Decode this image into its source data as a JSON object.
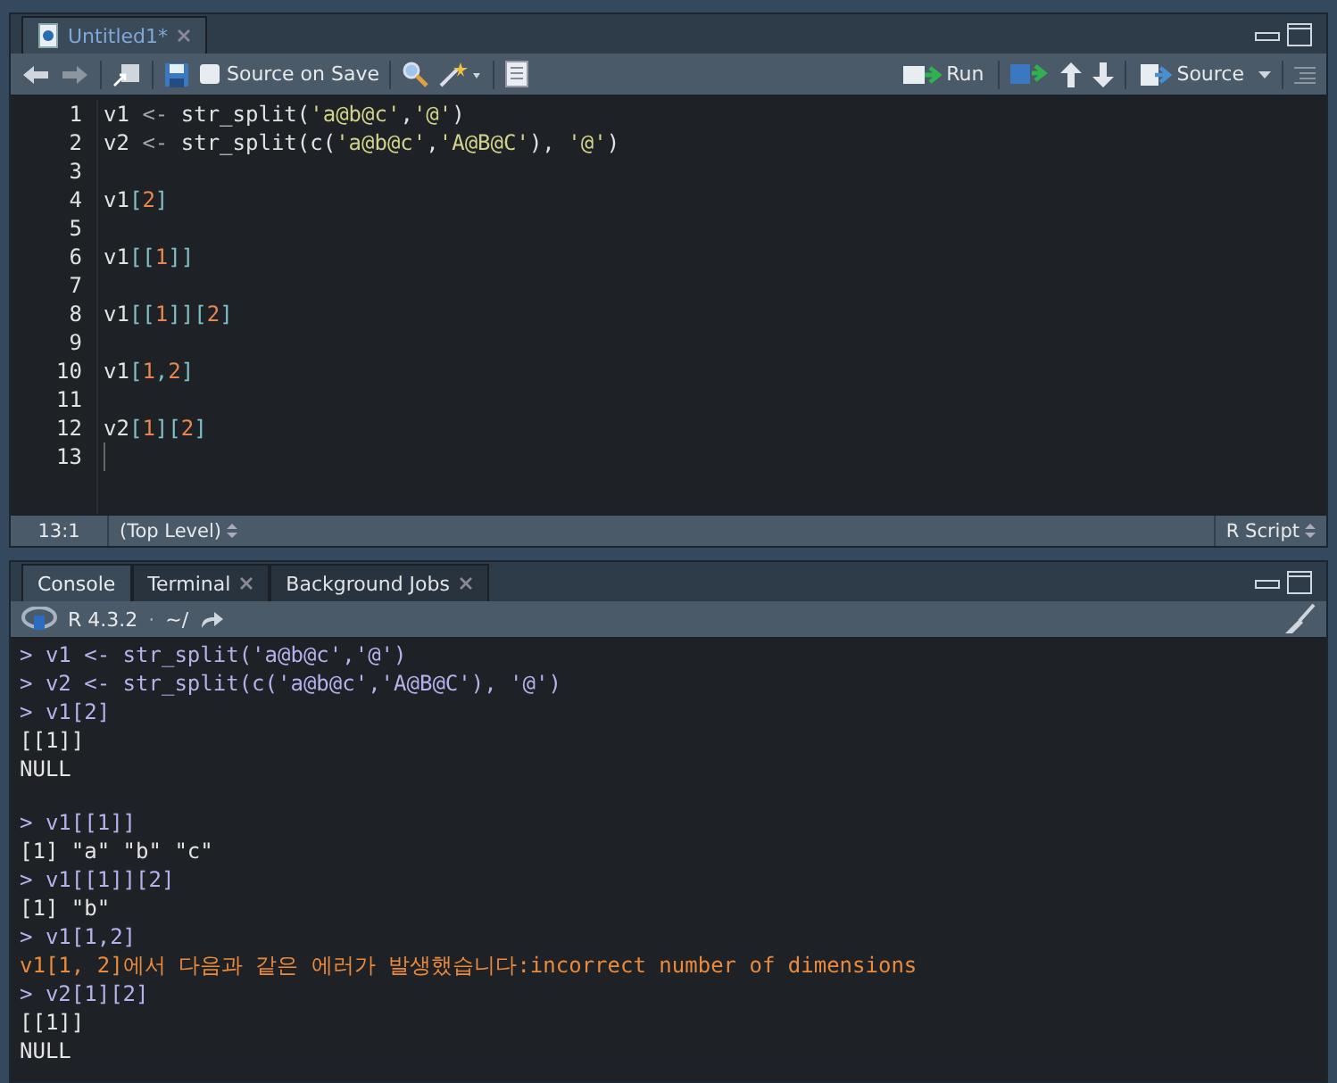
{
  "editor": {
    "tab": {
      "title": "Untitled1*",
      "selected": true
    },
    "toolbar": {
      "source_on_save": {
        "label": "Source on Save",
        "checked": false
      },
      "run": "Run",
      "source": "Source"
    },
    "lines": [
      {
        "number": "1",
        "tokens": [
          {
            "kind": "id",
            "text": "v1 "
          },
          {
            "kind": "op",
            "text": "<-"
          },
          {
            "kind": "id",
            "text": " str_split("
          },
          {
            "kind": "str",
            "text": "'a@b@c'"
          },
          {
            "kind": "id",
            "text": ","
          },
          {
            "kind": "str",
            "text": "'@'"
          },
          {
            "kind": "id",
            "text": ")"
          }
        ]
      },
      {
        "number": "2",
        "tokens": [
          {
            "kind": "id",
            "text": "v2 "
          },
          {
            "kind": "op",
            "text": "<-"
          },
          {
            "kind": "id",
            "text": " str_split(c("
          },
          {
            "kind": "str",
            "text": "'a@b@c'"
          },
          {
            "kind": "id",
            "text": ","
          },
          {
            "kind": "str",
            "text": "'A@B@C'"
          },
          {
            "kind": "id",
            "text": "), "
          },
          {
            "kind": "str",
            "text": "'@'"
          },
          {
            "kind": "id",
            "text": ")"
          }
        ]
      },
      {
        "number": "3"
      },
      {
        "number": "4",
        "tokens": [
          {
            "kind": "id",
            "text": "v1"
          },
          {
            "kind": "br",
            "text": "["
          },
          {
            "kind": "num",
            "text": "2"
          },
          {
            "kind": "br",
            "text": "]"
          }
        ]
      },
      {
        "number": "5"
      },
      {
        "number": "6",
        "tokens": [
          {
            "kind": "id",
            "text": "v1"
          },
          {
            "kind": "br",
            "text": "[["
          },
          {
            "kind": "num",
            "text": "1"
          },
          {
            "kind": "br",
            "text": "]]"
          }
        ]
      },
      {
        "number": "7"
      },
      {
        "number": "8",
        "tokens": [
          {
            "kind": "id",
            "text": "v1"
          },
          {
            "kind": "br",
            "text": "[["
          },
          {
            "kind": "num",
            "text": "1"
          },
          {
            "kind": "br",
            "text": "]]["
          },
          {
            "kind": "num",
            "text": "2"
          },
          {
            "kind": "br",
            "text": "]"
          }
        ]
      },
      {
        "number": "9"
      },
      {
        "number": "10",
        "tokens": [
          {
            "kind": "id",
            "text": "v1"
          },
          {
            "kind": "br",
            "text": "["
          },
          {
            "kind": "num",
            "text": "1"
          },
          {
            "kind": "br",
            "text": ","
          },
          {
            "kind": "num",
            "text": "2"
          },
          {
            "kind": "br",
            "text": "]"
          }
        ]
      },
      {
        "number": "11"
      },
      {
        "number": "12",
        "tokens": [
          {
            "kind": "id",
            "text": "v2"
          },
          {
            "kind": "br",
            "text": "["
          },
          {
            "kind": "num",
            "text": "1"
          },
          {
            "kind": "br",
            "text": "]["
          },
          {
            "kind": "num",
            "text": "2"
          },
          {
            "kind": "br",
            "text": "]"
          }
        ]
      },
      {
        "number": "13"
      }
    ],
    "status": {
      "position": "13:1",
      "scope": "(Top Level)",
      "filetype": "R Script"
    }
  },
  "console": {
    "tabs": [
      {
        "label": "Console",
        "selected": true,
        "closable": false
      },
      {
        "label": "Terminal",
        "selected": false,
        "closable": true
      },
      {
        "label": "Background Jobs",
        "selected": false,
        "closable": true
      }
    ],
    "version": "R 4.3.2",
    "separator": "·",
    "path": "~/",
    "lines": [
      {
        "kind": "input",
        "text": "> v1 <- str_split('a@b@c','@')"
      },
      {
        "kind": "input",
        "text": "> v2 <- str_split(c('a@b@c','A@B@C'), '@')"
      },
      {
        "kind": "input",
        "text": "> v1[2]"
      },
      {
        "kind": "output",
        "text": "[[1]]"
      },
      {
        "kind": "output",
        "text": "NULL"
      },
      {
        "kind": "blank"
      },
      {
        "kind": "input",
        "text": "> v1[[1]]"
      },
      {
        "kind": "output",
        "text": "[1] \"a\" \"b\" \"c\""
      },
      {
        "kind": "input",
        "text": "> v1[[1]][2]"
      },
      {
        "kind": "output",
        "text": "[1] \"b\""
      },
      {
        "kind": "input",
        "text": "> v1[1,2]"
      },
      {
        "kind": "error",
        "text": "v1[1, 2]에서 다음과 같은 에러가 발생했습니다:incorrect number of dimensions"
      },
      {
        "kind": "input",
        "text": "> v2[1][2]"
      },
      {
        "kind": "output",
        "text": "[[1]]"
      },
      {
        "kind": "output",
        "text": "NULL"
      }
    ]
  }
}
